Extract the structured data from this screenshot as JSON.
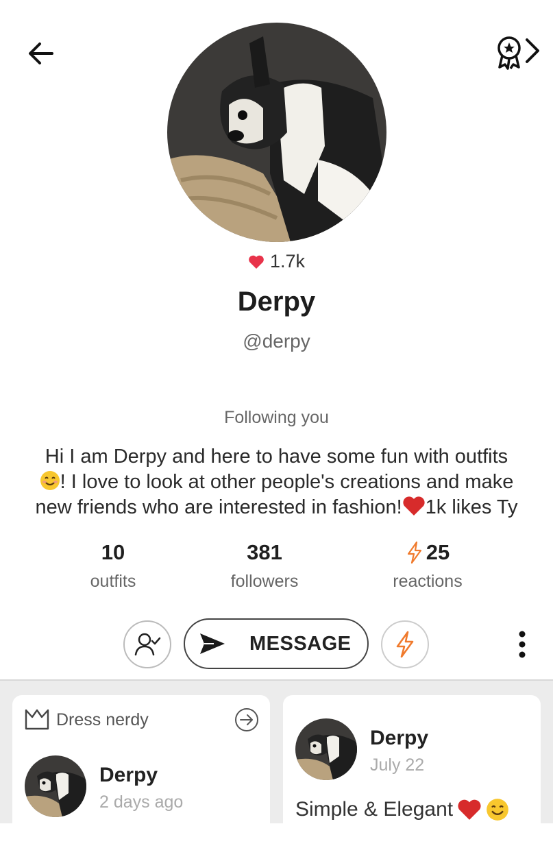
{
  "profile": {
    "likes": "1.7k",
    "name": "Derpy",
    "handle": "@derpy",
    "following_status": "Following you",
    "bio_line1": "Hi I am Derpy and here to have some fun with outfits",
    "bio_line2": "! I love to look at other people's creations and make",
    "bio_line3a": "new friends who are interested in fashion!",
    "bio_line3b": "1k likes Ty"
  },
  "stats": {
    "outfits": {
      "value": "10",
      "label": "outfits"
    },
    "followers": {
      "value": "381",
      "label": "followers"
    },
    "reactions": {
      "value": "25",
      "label": "reactions"
    }
  },
  "actions": {
    "message_label": "MESSAGE"
  },
  "feed": {
    "cards": [
      {
        "tag": "Dress nerdy",
        "author": "Derpy",
        "time": "2 days ago"
      },
      {
        "author": "Derpy",
        "time": "July 22",
        "text": "Simple & Elegant"
      }
    ]
  },
  "icons": {
    "back": "arrow-left-icon",
    "badges": "award-ribbon-chevron-icon",
    "heart": "heart-icon",
    "follow": "user-check-icon",
    "send": "send-icon",
    "lightning": "lightning-icon",
    "more": "more-vertical-icon",
    "crown": "crown-icon",
    "arrow_circle": "arrow-right-circle-icon"
  },
  "colors": {
    "heart": "#e8334a",
    "lightning": "#f07a2c",
    "feed_bg": "#ececec"
  }
}
